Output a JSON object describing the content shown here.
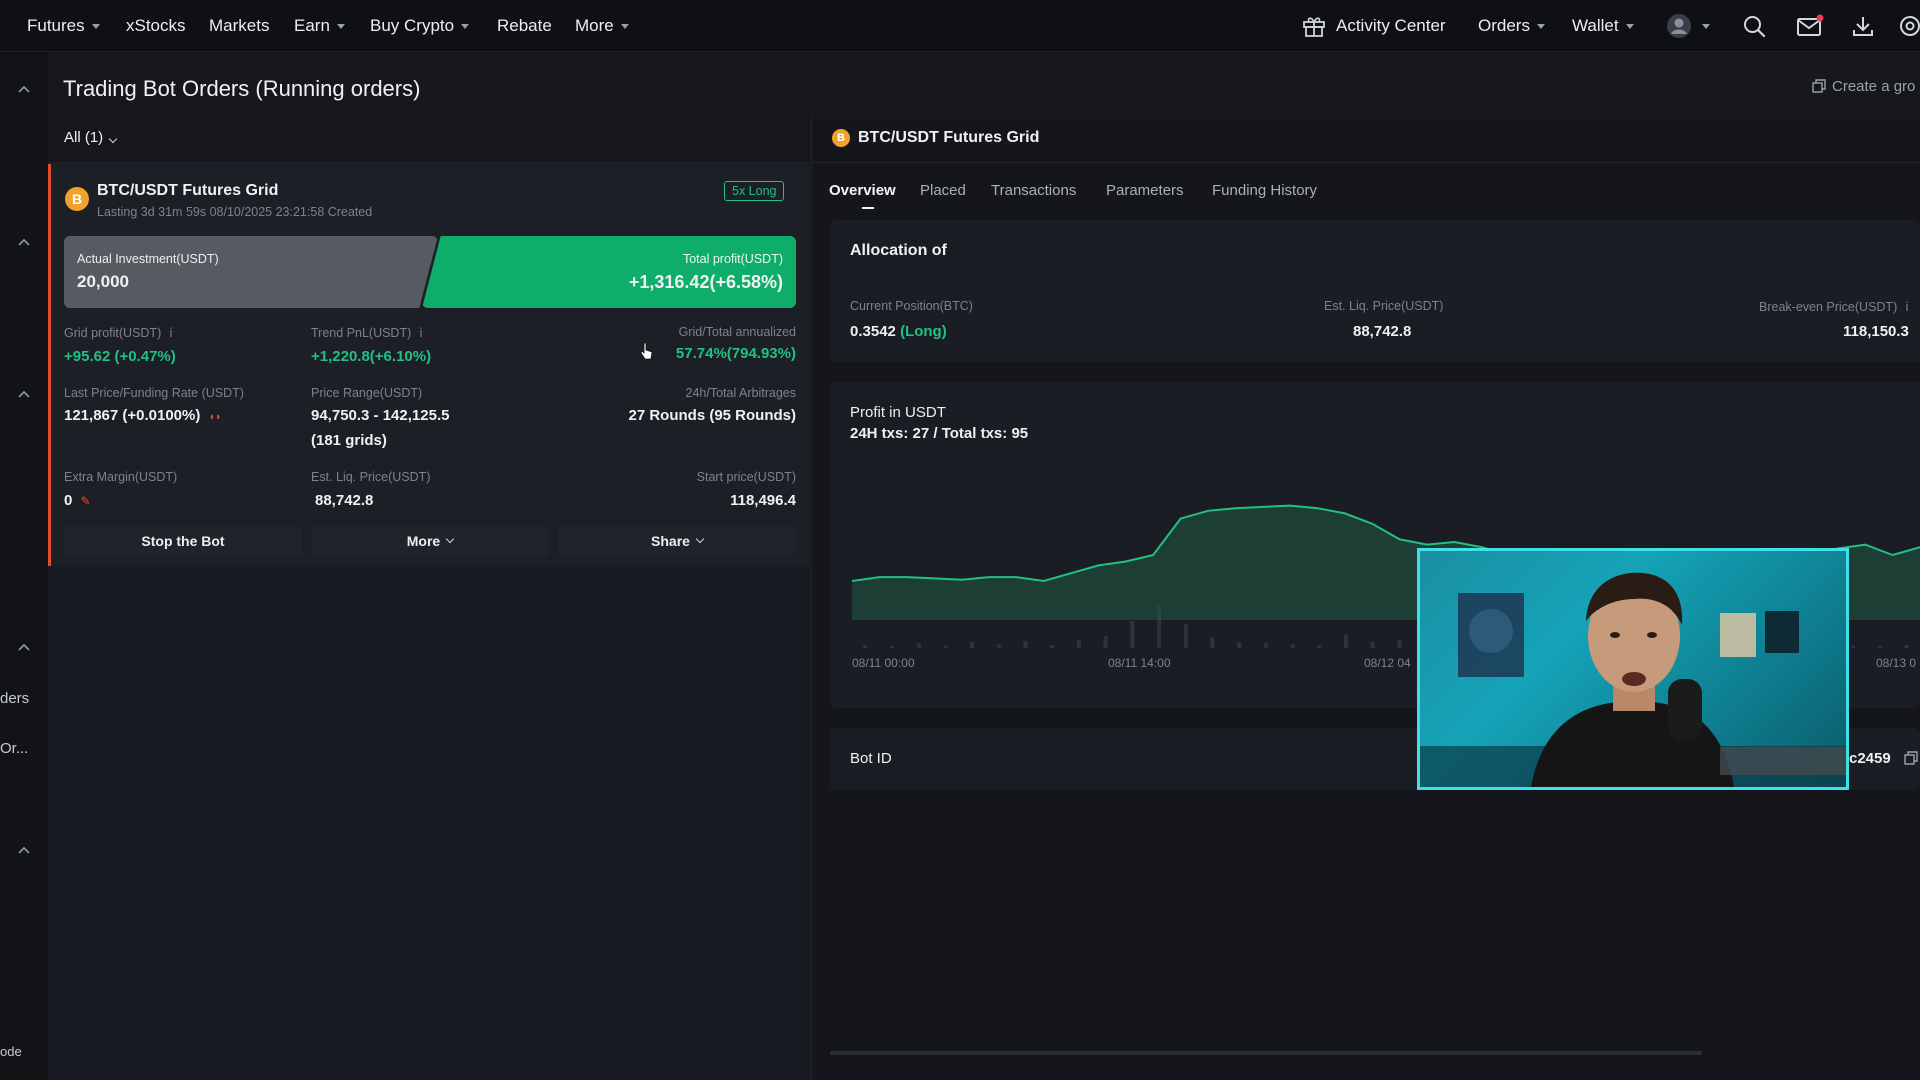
{
  "nav": {
    "left": [
      {
        "label": "Futures",
        "caret": true
      },
      {
        "label": "xStocks",
        "caret": false
      },
      {
        "label": "Markets",
        "caret": false
      },
      {
        "label": "Earn",
        "caret": true
      },
      {
        "label": "Buy Crypto",
        "caret": true
      },
      {
        "label": "Rebate",
        "caret": false
      },
      {
        "label": "More",
        "caret": true
      }
    ],
    "activity_center": "Activity Center",
    "orders": "Orders",
    "wallet": "Wallet"
  },
  "rail": {
    "text1": "ders",
    "text2": "Or...",
    "text3": "ode"
  },
  "page": {
    "title": "Trading Bot Orders (Running orders)",
    "create_group": "Create a gro"
  },
  "filter": {
    "label": "All (1)"
  },
  "bot": {
    "coin_symbol": "B",
    "name": "BTC/USDT Futures Grid",
    "subtitle": "Lasting 3d 31m 59s 08/10/2025 23:21:58 Created",
    "badge": "5x Long",
    "investment_label": "Actual Investment(USDT)",
    "investment_value": "20,000",
    "profit_label": "Total profit(USDT)",
    "profit_value": "+1,316.42(+6.58%)",
    "grid_profit_label": "Grid profit(USDT)",
    "grid_profit_value": "+95.62 (+0.47%)",
    "trend_pnl_label": "Trend PnL(USDT)",
    "trend_pnl_value": "+1,220.8(+6.10%)",
    "annualized_label": "Grid/Total annualized",
    "annualized_value": "57.74%(794.93%)",
    "last_price_label": "Last Price/Funding Rate (USDT)",
    "last_price_value": "121,867 (+0.0100%)",
    "price_range_label": "Price Range(USDT)",
    "price_range_value": "94,750.3 - 142,125.5",
    "grids_value": "(181 grids)",
    "arbitrages_label": "24h/Total Arbitrages",
    "arbitrages_value": "27 Rounds (95 Rounds)",
    "extra_margin_label": "Extra Margin(USDT)",
    "extra_margin_value": "0",
    "liq_price_label": "Est. Liq. Price(USDT)",
    "liq_price_value": "88,742.8",
    "start_price_label": "Start price(USDT)",
    "start_price_value": "118,496.4",
    "stop_label": "Stop the Bot",
    "more_label": "More",
    "share_label": "Share"
  },
  "detail": {
    "title": "BTC/USDT Futures Grid",
    "tabs": [
      "Overview",
      "Placed",
      "Transactions",
      "Parameters",
      "Funding History"
    ],
    "allocation_title": "Allocation of",
    "position_label": "Current Position(BTC)",
    "position_value": "0.3542",
    "position_side": "(Long)",
    "liq_label": "Est. Liq. Price(USDT)",
    "liq_value": "88,742.8",
    "breakeven_label": "Break-even Price(USDT)",
    "breakeven_value": "118,150.3",
    "profit_title": "Profit in USDT",
    "txs_text": "24H txs: 27 / Total txs: 95",
    "bot_id_label": "Bot ID",
    "bot_id_value": "c2459"
  },
  "colors": {
    "accent_green": "#21c083",
    "profit_box": "#0ead69",
    "card_border_red": "#e04d2d",
    "webcam_border": "#3fe0e8"
  },
  "chart_data": {
    "type": "area",
    "x_tick_labels": [
      "08/11 00:00",
      "08/11 14:00",
      "08/12 04",
      "08/13 0"
    ],
    "profit_series": [
      0.3,
      0.33,
      0.33,
      0.32,
      0.31,
      0.33,
      0.33,
      0.3,
      0.36,
      0.42,
      0.45,
      0.5,
      0.78,
      0.84,
      0.86,
      0.87,
      0.88,
      0.86,
      0.82,
      0.74,
      0.62,
      0.58,
      0.6,
      0.56,
      0.5,
      0.45,
      0.5,
      0.48,
      0.46,
      0.4,
      0.36,
      0.38,
      0.4,
      0.42,
      0.44,
      0.5,
      0.55,
      0.58,
      0.5,
      0.56
    ],
    "volume_series": [
      0.05,
      0.03,
      0.08,
      0.04,
      0.1,
      0.06,
      0.12,
      0.05,
      0.14,
      0.2,
      0.45,
      0.7,
      0.4,
      0.18,
      0.1,
      0.08,
      0.06,
      0.05,
      0.22,
      0.1,
      0.14,
      0.08,
      0.05,
      0.06,
      0.1,
      0.04,
      0.08,
      0.05,
      0.04,
      0.03,
      0.05,
      0.04,
      0.06,
      0.05,
      0.04,
      0.03,
      0.05,
      0.04,
      0.03,
      0.05
    ]
  }
}
